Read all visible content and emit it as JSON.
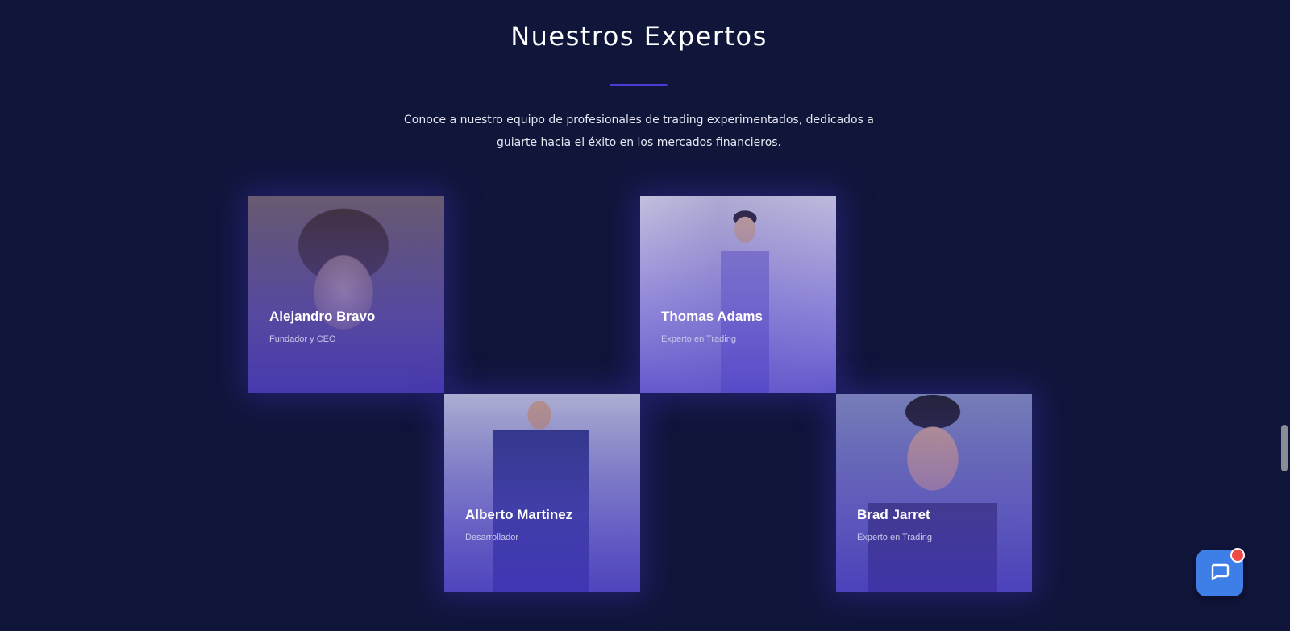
{
  "section": {
    "title": "Nuestros Expertos",
    "description": "Conoce a nuestro equipo de profesionales de trading experimentados, dedicados a guiarte hacia el éxito en los mercados financieros."
  },
  "team": [
    {
      "name": "Alejandro Bravo",
      "role": "Fundador y CEO"
    },
    {
      "name": "Thomas Adams",
      "role": "Experto en Trading"
    },
    {
      "name": "Alberto Martinez",
      "role": "Desarrollador"
    },
    {
      "name": "Brad Jarret",
      "role": "Experto en Trading"
    }
  ],
  "chat": {
    "icon": "chat-bubble-icon",
    "badge": "notification-dot"
  },
  "colors": {
    "background": "#10153a",
    "accent": "#4b3bd6",
    "chat": "#3d7fe6",
    "badge": "#f04a46"
  }
}
